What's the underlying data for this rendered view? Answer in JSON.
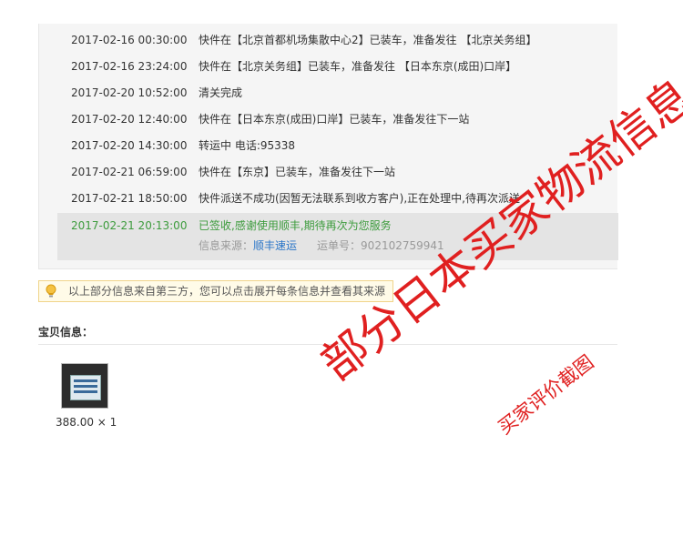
{
  "tracking": {
    "events": [
      {
        "time": "2017-02-16 00:30:00",
        "desc": "快件在【北京首都机场集散中心2】已装车，准备发往 【北京关务组】"
      },
      {
        "time": "2017-02-16 23:24:00",
        "desc": "快件在【北京关务组】已装车，准备发往 【日本东京(成田)口岸】"
      },
      {
        "time": "2017-02-20 10:52:00",
        "desc": "清关完成"
      },
      {
        "time": "2017-02-20 12:40:00",
        "desc": "快件在【日本东京(成田)口岸】已装车，准备发往下一站"
      },
      {
        "time": "2017-02-20 14:30:00",
        "desc": "转运中 电话:95338"
      },
      {
        "time": "2017-02-21 06:59:00",
        "desc": "快件在【东京】已装车，准备发往下一站"
      },
      {
        "time": "2017-02-21 18:50:00",
        "desc": "快件派送不成功(因暂无法联系到收方客户),正在处理中,待再次派送"
      }
    ],
    "latest": {
      "time": "2017-02-21 20:13:00",
      "desc": "已签收,感谢使用顺丰,期待再次为您服务",
      "source_label": "信息来源：",
      "source_name": "顺丰速运",
      "waybill_label": "运单号：",
      "waybill_no": "902102759941"
    }
  },
  "notice": {
    "text": "以上部分信息来自第三方，您可以点击展开每条信息并查看其来源",
    "icon": "lightbulb-icon"
  },
  "items": {
    "title": "宝贝信息：",
    "price_qty": "388.00 × 1"
  },
  "watermark": {
    "main": "部分日本买家物流信息",
    "sub": "买家评价截图",
    "color": "#e02020"
  },
  "colors": {
    "delivered": "#3c9b3c",
    "link": "#2b76c8"
  }
}
